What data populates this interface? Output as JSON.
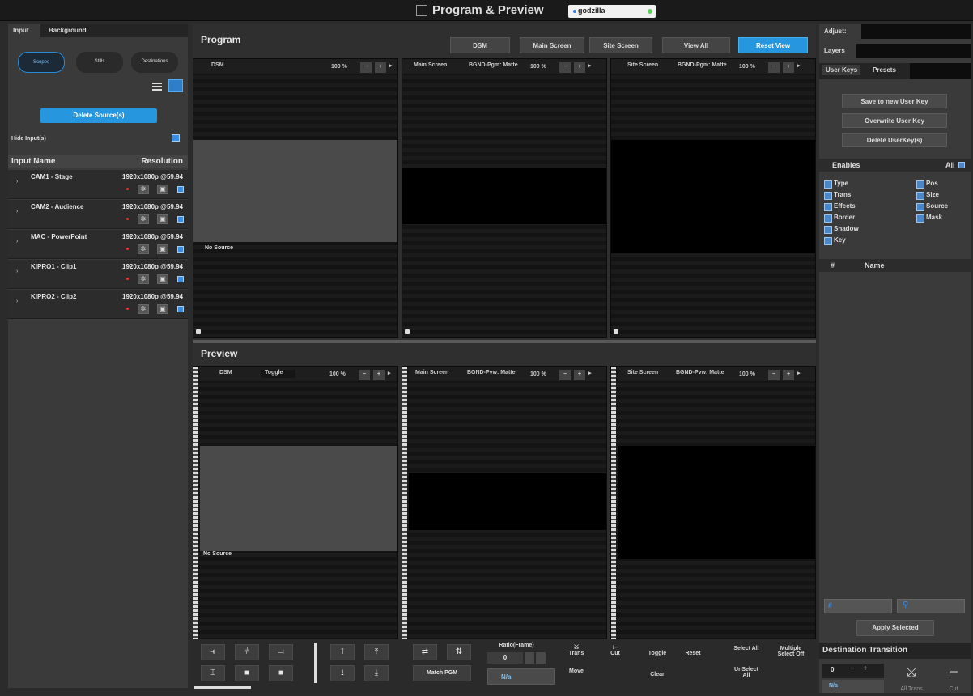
{
  "window": {
    "title": "Program & Preview",
    "show_name": "godzilla"
  },
  "left": {
    "tabs": [
      "Input",
      "Background"
    ],
    "view_buttons": [
      "Scopes",
      "Stills",
      "Destinations"
    ],
    "delete_button": "Delete Source(s)",
    "hide_inputs_label": "Hide Input(s)",
    "columns": {
      "name": "Input Name",
      "resolution": "Resolution"
    },
    "inputs": [
      {
        "name": "CAM1 - Stage",
        "resolution": "1920x1080p @59.94"
      },
      {
        "name": "CAM2 - Audience",
        "resolution": "1920x1080p @59.94"
      },
      {
        "name": "MAC - PowerPoint",
        "resolution": "1920x1080p @59.94"
      },
      {
        "name": "KIPRO1 - Clip1",
        "resolution": "1920x1080p @59.94"
      },
      {
        "name": "KIPRO2 - Clip2",
        "resolution": "1920x1080p @59.94"
      }
    ]
  },
  "program": {
    "title": "Program",
    "buttons": [
      "DSM",
      "Main Screen",
      "Site Screen",
      "View All",
      "Reset View"
    ],
    "panels": [
      {
        "dest": "DSM",
        "bgnd": "",
        "zoom": "100 %",
        "source_label": "No Source"
      },
      {
        "dest": "Main Screen",
        "bgnd": "BGND-Pgm: Matte",
        "zoom": "100 %"
      },
      {
        "dest": "Site Screen",
        "bgnd": "BGND-Pgm: Matte",
        "zoom": "100 %"
      }
    ]
  },
  "preview": {
    "title": "Preview",
    "panels": [
      {
        "dest": "DSM",
        "toggle": "Toggle",
        "zoom": "100 %",
        "source_label": "No Source"
      },
      {
        "dest": "Main Screen",
        "bgnd": "BGND-Pvw: Matte",
        "zoom": "100 %"
      },
      {
        "dest": "Site Screen",
        "bgnd": "BGND-Pvw: Matte",
        "zoom": "100 %"
      }
    ]
  },
  "toolbar": {
    "ratio_label": "Ratio(Frame)",
    "ratio_value": "0",
    "na_value": "N/a",
    "match_pgm": "Match PGM",
    "trans": "Trans",
    "cut": "Cut",
    "move": "Move",
    "toggle": "Toggle",
    "reset": "Reset",
    "clear": "Clear",
    "select_all": "Select All",
    "multiple_select_off": "Multiple Select Off",
    "unselect_all": "UnSelect All"
  },
  "right": {
    "adjust_label": "Adjust:",
    "layers_label": "Layers",
    "tabs": [
      "User Keys",
      "Presets"
    ],
    "buttons": [
      "Save to new User Key",
      "Overwrite User Key",
      "Delete UserKey(s)"
    ],
    "enables_title": "Enables",
    "all_label": "All",
    "enables_left": [
      "Type",
      "Trans",
      "Effects",
      "Border",
      "Shadow",
      "Key"
    ],
    "enables_right": [
      "Pos",
      "Size",
      "Source",
      "Mask"
    ],
    "list_cols": {
      "num": "#",
      "name": "Name"
    },
    "apply_button": "Apply Selected",
    "dest_transition": "Destination Transition",
    "dt_value": "0",
    "dt_na": "N/a",
    "all_trans": "All Trans",
    "cut": "Cut"
  },
  "colors": {
    "accent": "#2696de",
    "panel_bg": "#3a3a3a",
    "viewport": "#151515"
  }
}
